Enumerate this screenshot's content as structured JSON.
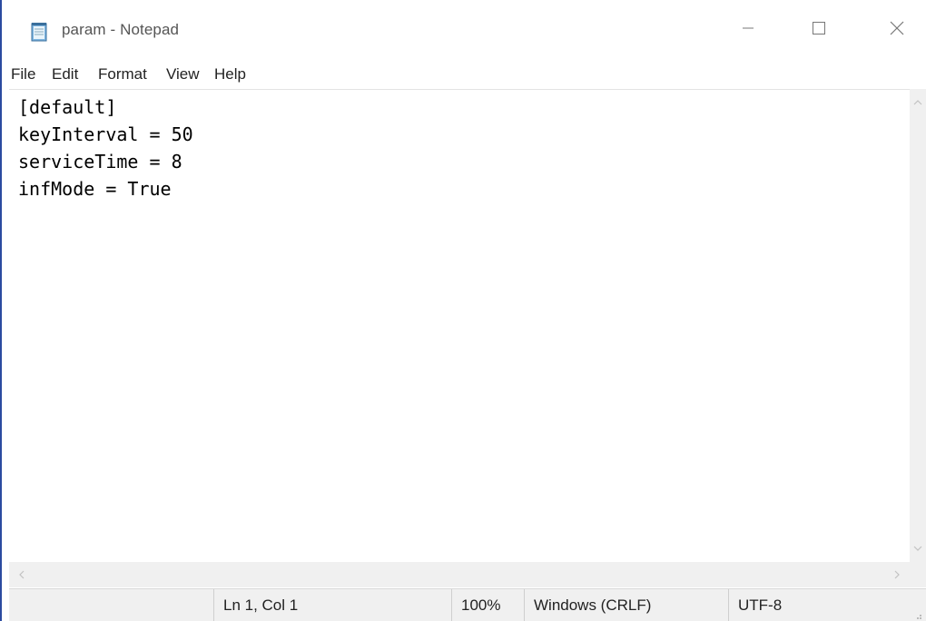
{
  "window": {
    "title": "param - Notepad",
    "app_icon": "notepad-icon"
  },
  "title_buttons": {
    "minimize_icon": "minimize-icon",
    "maximize_icon": "maximize-icon",
    "close_icon": "close-icon"
  },
  "menu": {
    "items": [
      {
        "label": "File"
      },
      {
        "label": "Edit"
      },
      {
        "label": "Format"
      },
      {
        "label": "View"
      },
      {
        "label": "Help"
      }
    ]
  },
  "editor": {
    "content": "[default]\nkeyInterval = 50\nserviceTime = 8\ninfMode = True"
  },
  "statusbar": {
    "position": "Ln 1, Col 1",
    "zoom": "100%",
    "line_endings": "Windows (CRLF)",
    "encoding": "UTF-8"
  },
  "colors": {
    "window_border": "#2b4aa0",
    "status_bg": "#f0f0f0"
  }
}
